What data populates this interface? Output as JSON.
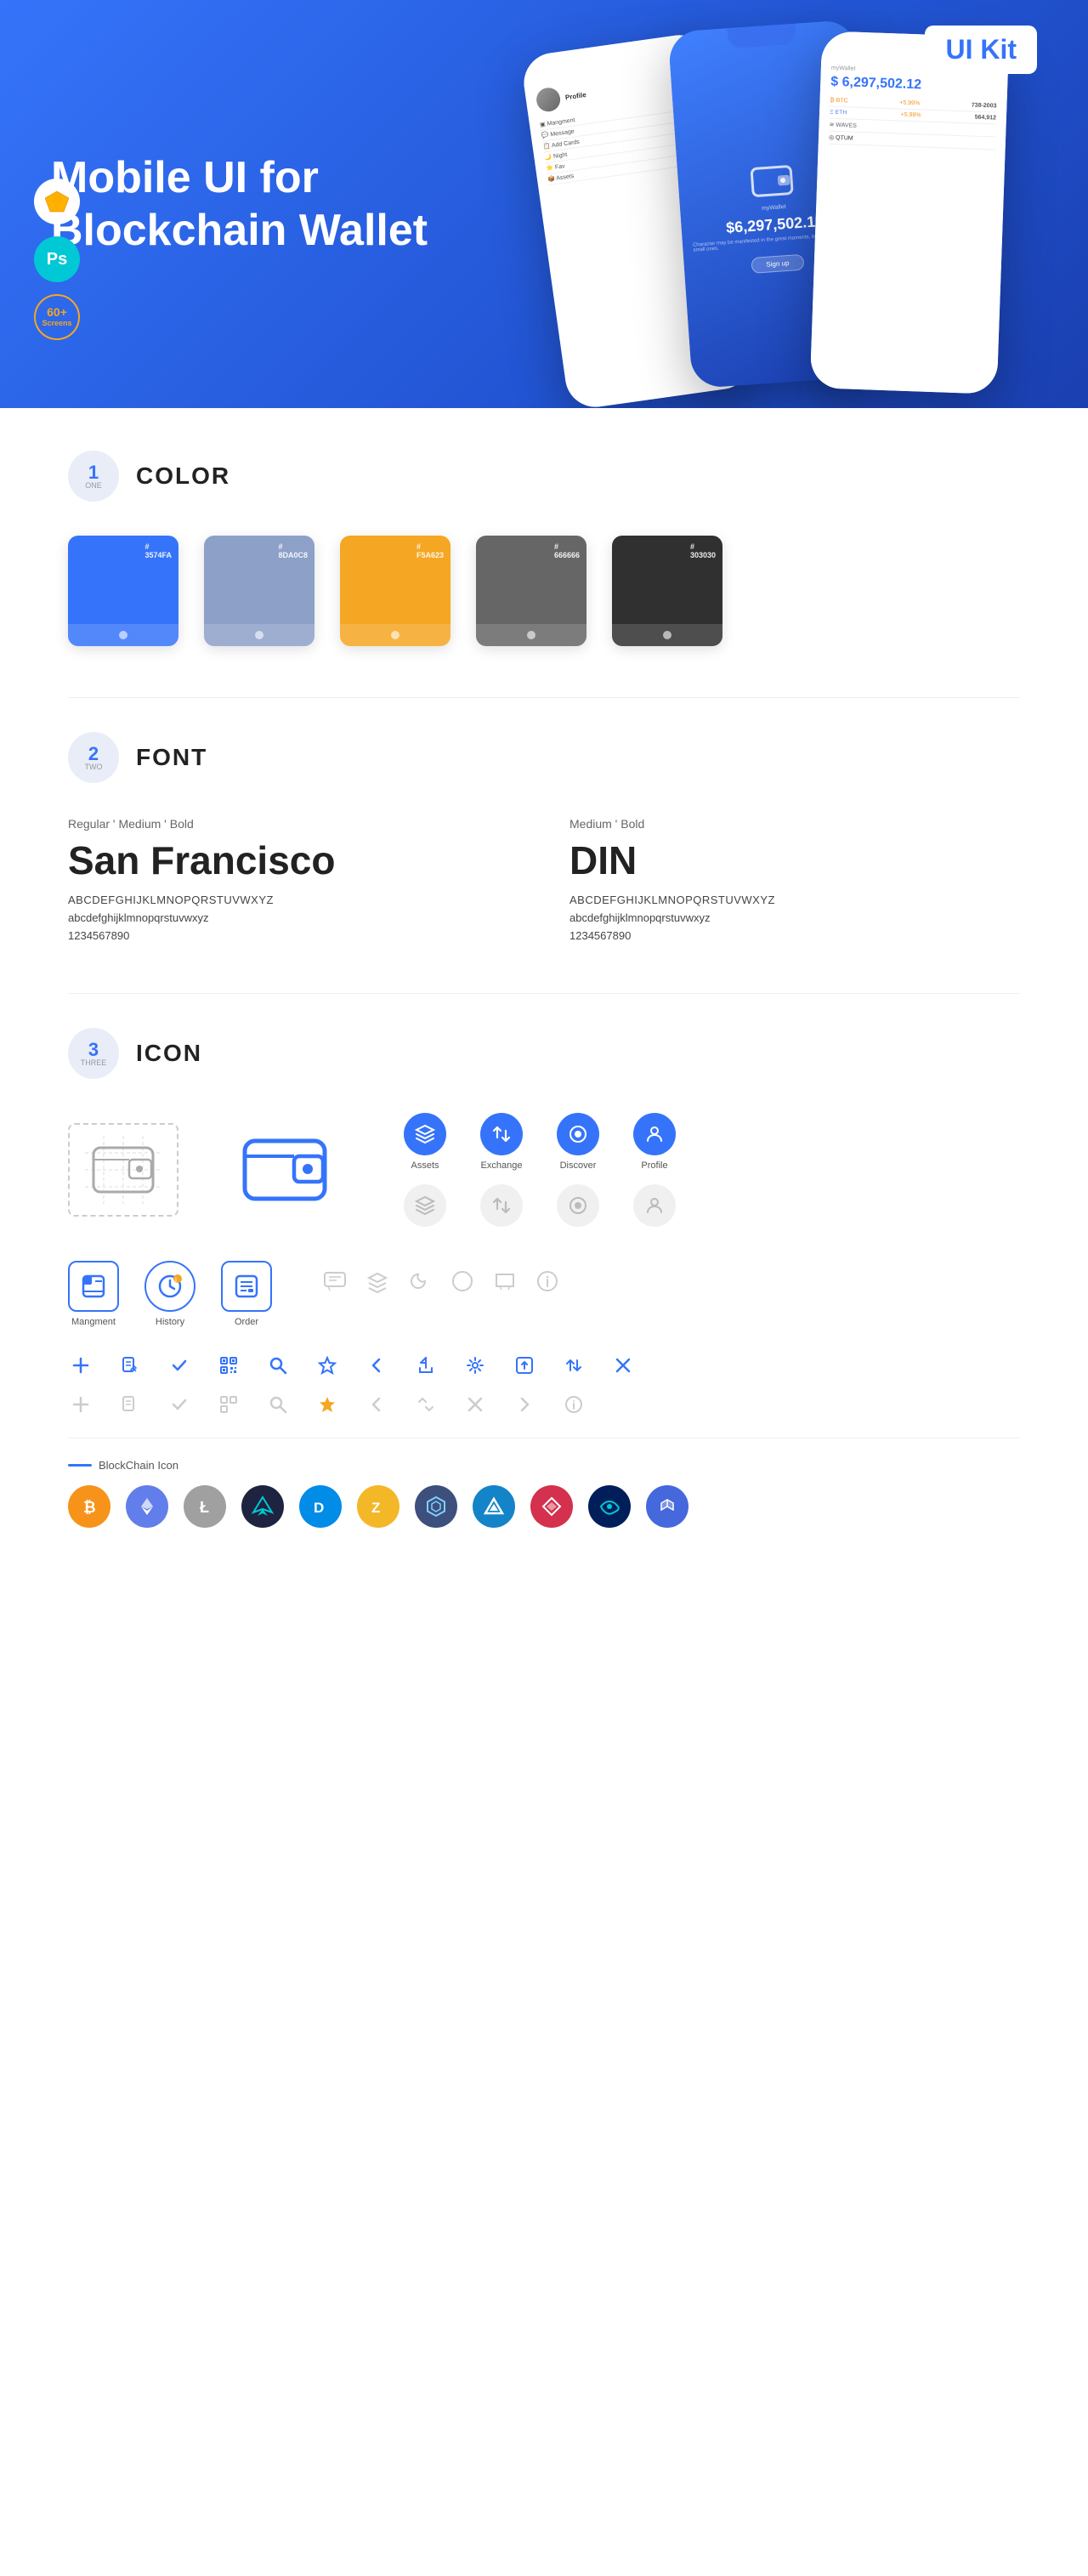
{
  "hero": {
    "title_regular": "Mobile UI for Blockchain ",
    "title_bold": "Wallet",
    "badge": "UI Kit",
    "sketch_icon": "🔶",
    "ps_icon": "Ps",
    "screens_count": "60+",
    "screens_label": "Screens"
  },
  "sections": {
    "color": {
      "number": "1",
      "number_sub": "ONE",
      "title": "COLOR",
      "swatches": [
        {
          "hex": "#3574FA",
          "code": "#\n3574FA"
        },
        {
          "hex": "#8DA0C8",
          "code": "#\n8DA0C8"
        },
        {
          "hex": "#F5A623",
          "code": "#\nF5A623"
        },
        {
          "hex": "#666666",
          "code": "#\n666666"
        },
        {
          "hex": "#303030",
          "code": "#\n303030"
        }
      ]
    },
    "font": {
      "number": "2",
      "number_sub": "TWO",
      "title": "FONT",
      "fonts": [
        {
          "style_label": "Regular ' Medium ' Bold",
          "name": "San Francisco",
          "uppercase": "ABCDEFGHIJKLMNOPQRSTUVWXYZ",
          "lowercase": "abcdefghijklmnopqrstuvwxyz",
          "numbers": "1234567890"
        },
        {
          "style_label": "Medium ' Bold",
          "name": "DIN",
          "uppercase": "ABCDEFGHIJKLMNOPQRSTUVWXYZ",
          "lowercase": "abcdefghijklmnopqrstuvwxyz",
          "numbers": "1234567890"
        }
      ]
    },
    "icon": {
      "number": "3",
      "number_sub": "THREE",
      "title": "ICON",
      "nav_icons": [
        {
          "label": "Assets",
          "filled": true
        },
        {
          "label": "Exchange",
          "filled": true
        },
        {
          "label": "Discover",
          "filled": true
        },
        {
          "label": "Profile",
          "filled": true
        }
      ],
      "app_icons": [
        {
          "label": "Mangment"
        },
        {
          "label": "History"
        },
        {
          "label": "Order"
        }
      ],
      "blockchain_label": "BlockChain Icon",
      "crypto_coins": [
        {
          "symbol": "₿",
          "name": "Bitcoin",
          "class": "crypto-btc"
        },
        {
          "symbol": "Ξ",
          "name": "Ethereum",
          "class": "crypto-eth"
        },
        {
          "symbol": "Ł",
          "name": "Litecoin",
          "class": "crypto-ltc"
        },
        {
          "symbol": "W",
          "name": "Wings",
          "class": "crypto-wings"
        },
        {
          "symbol": "D",
          "name": "Dash",
          "class": "crypto-dash"
        },
        {
          "symbol": "Z",
          "name": "Zcash",
          "class": "crypto-zcash"
        },
        {
          "symbol": "⬡",
          "name": "Grid",
          "class": "crypto-grid"
        },
        {
          "symbol": "△",
          "name": "Strat",
          "class": "crypto-strat"
        },
        {
          "symbol": "▲",
          "name": "Ark",
          "class": "crypto-ark"
        },
        {
          "symbol": "◈",
          "name": "Golem",
          "class": "crypto-golem"
        },
        {
          "symbol": "▶",
          "name": "Poly",
          "class": "crypto-poly"
        }
      ]
    }
  }
}
